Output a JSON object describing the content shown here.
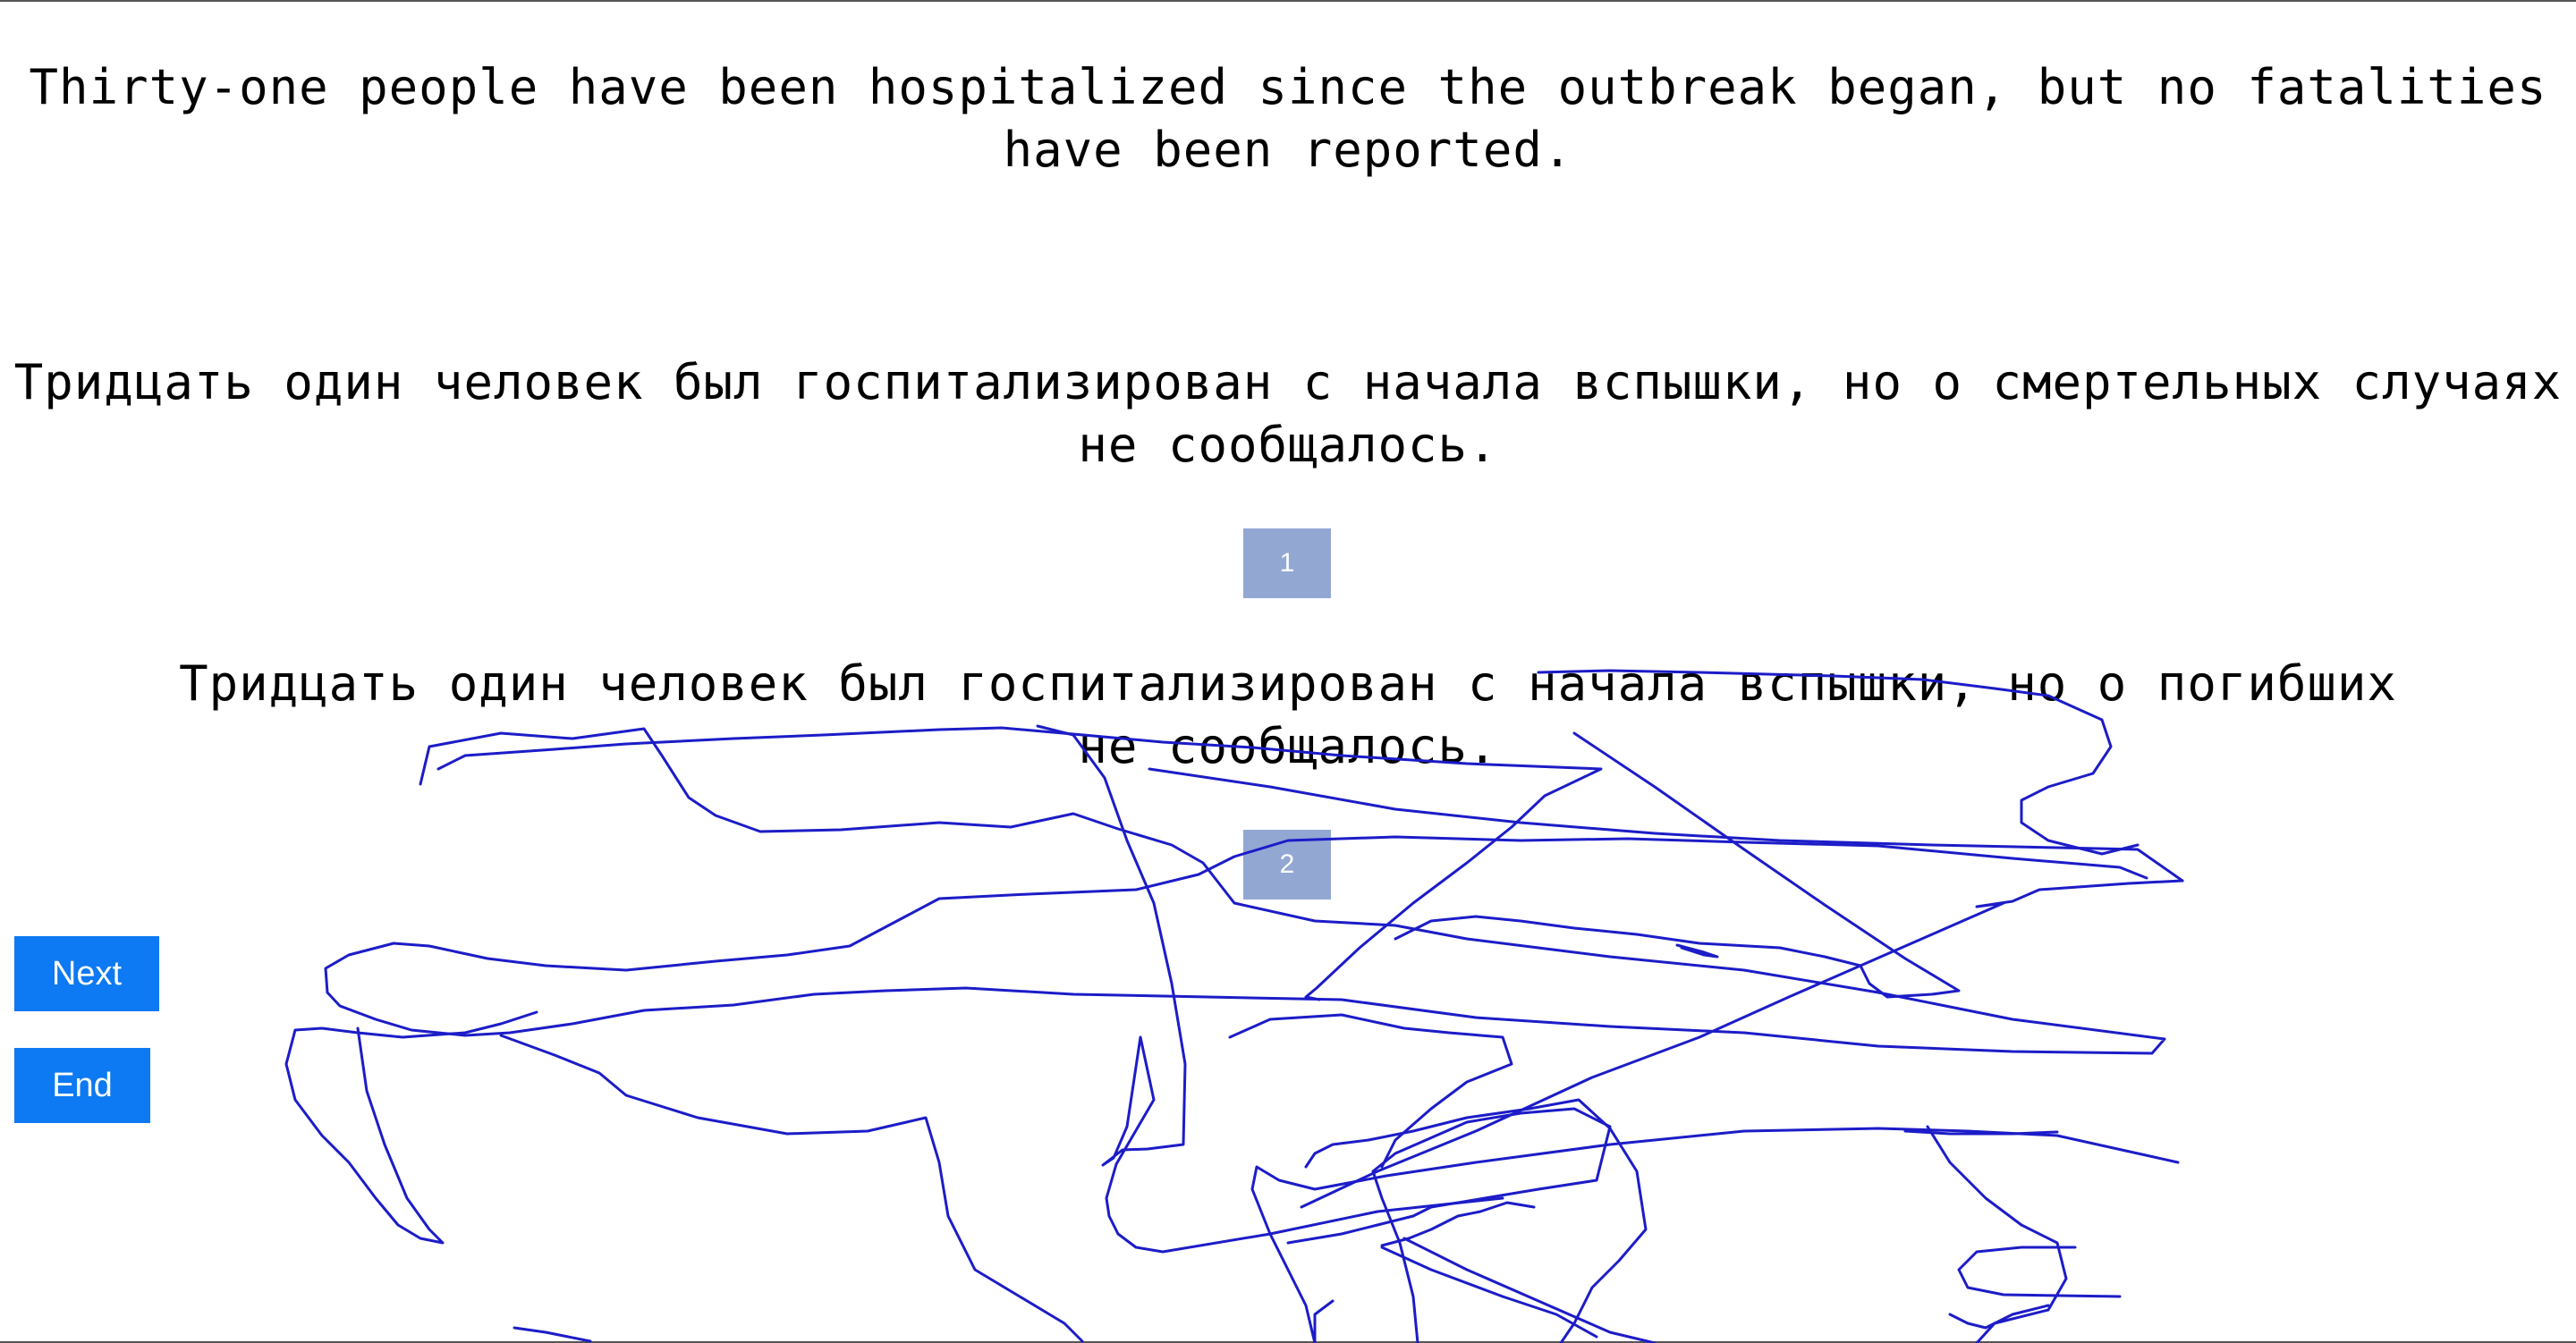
{
  "source": {
    "text": "Thirty-one people have been hospitalized since the outbreak began, but no fatalities have been reported."
  },
  "translations": [
    {
      "number": "1",
      "text": "Тридцать один человек был госпитализирован с начала вспышки, но о смертельных случаях не сообщалось."
    },
    {
      "number": "2",
      "text": "Тридцать один человек был госпитализирован с начала вспышки, но о погибших не сообщалось."
    }
  ],
  "controls": {
    "next_label": "Next",
    "end_label": "End"
  },
  "colors": {
    "badge": "#93a7d3",
    "button": "#0d79f2",
    "scribble": "#1c1cc8"
  }
}
